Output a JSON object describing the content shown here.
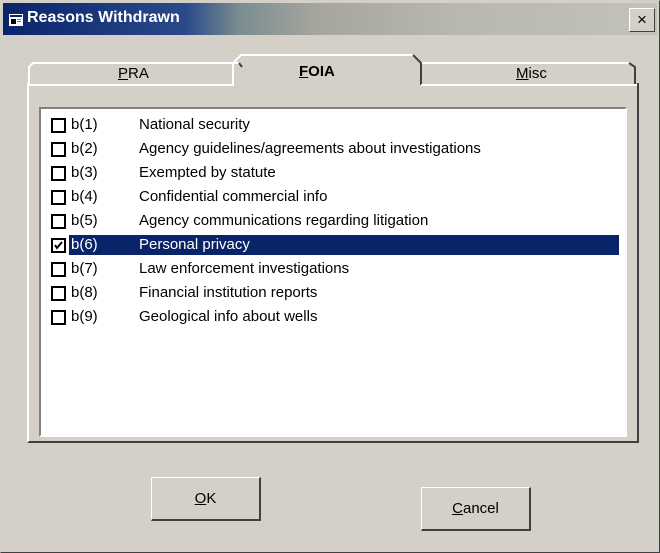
{
  "window": {
    "title": "Reasons Withdrawn",
    "close_label": "×"
  },
  "tabs": [
    {
      "id": "pra",
      "label": "PRA",
      "mnemonic": "P",
      "rest": "RA",
      "active": false
    },
    {
      "id": "foia",
      "label": "FOIA",
      "mnemonic": "F",
      "rest": "OIA",
      "active": true
    },
    {
      "id": "misc",
      "label": "Misc",
      "mnemonic": "M",
      "rest": "isc",
      "active": false
    }
  ],
  "items": [
    {
      "code": "b(1)",
      "description": "National security",
      "checked": false,
      "selected": false
    },
    {
      "code": "b(2)",
      "description": "Agency guidelines/agreements about investigations",
      "checked": false,
      "selected": false
    },
    {
      "code": "b(3)",
      "description": "Exempted by statute",
      "checked": false,
      "selected": false
    },
    {
      "code": "b(4)",
      "description": "Confidential commercial info",
      "checked": false,
      "selected": false
    },
    {
      "code": "b(5)",
      "description": "Agency communications regarding litigation",
      "checked": false,
      "selected": false
    },
    {
      "code": "b(6)",
      "description": "Personal privacy",
      "checked": true,
      "selected": true
    },
    {
      "code": "b(7)",
      "description": "Law enforcement investigations",
      "checked": false,
      "selected": false
    },
    {
      "code": "b(8)",
      "description": "Financial institution reports",
      "checked": false,
      "selected": false
    },
    {
      "code": "b(9)",
      "description": "Geological info about wells",
      "checked": false,
      "selected": false
    }
  ],
  "buttons": {
    "ok": {
      "label": "OK",
      "mnemonic": "O",
      "rest": "K"
    },
    "cancel": {
      "label": "Cancel",
      "mnemonic": "C",
      "rest": "ancel"
    }
  },
  "colors": {
    "face": "#d4d0c8",
    "selection": "#0a246a",
    "title_start": "#0a246a"
  }
}
